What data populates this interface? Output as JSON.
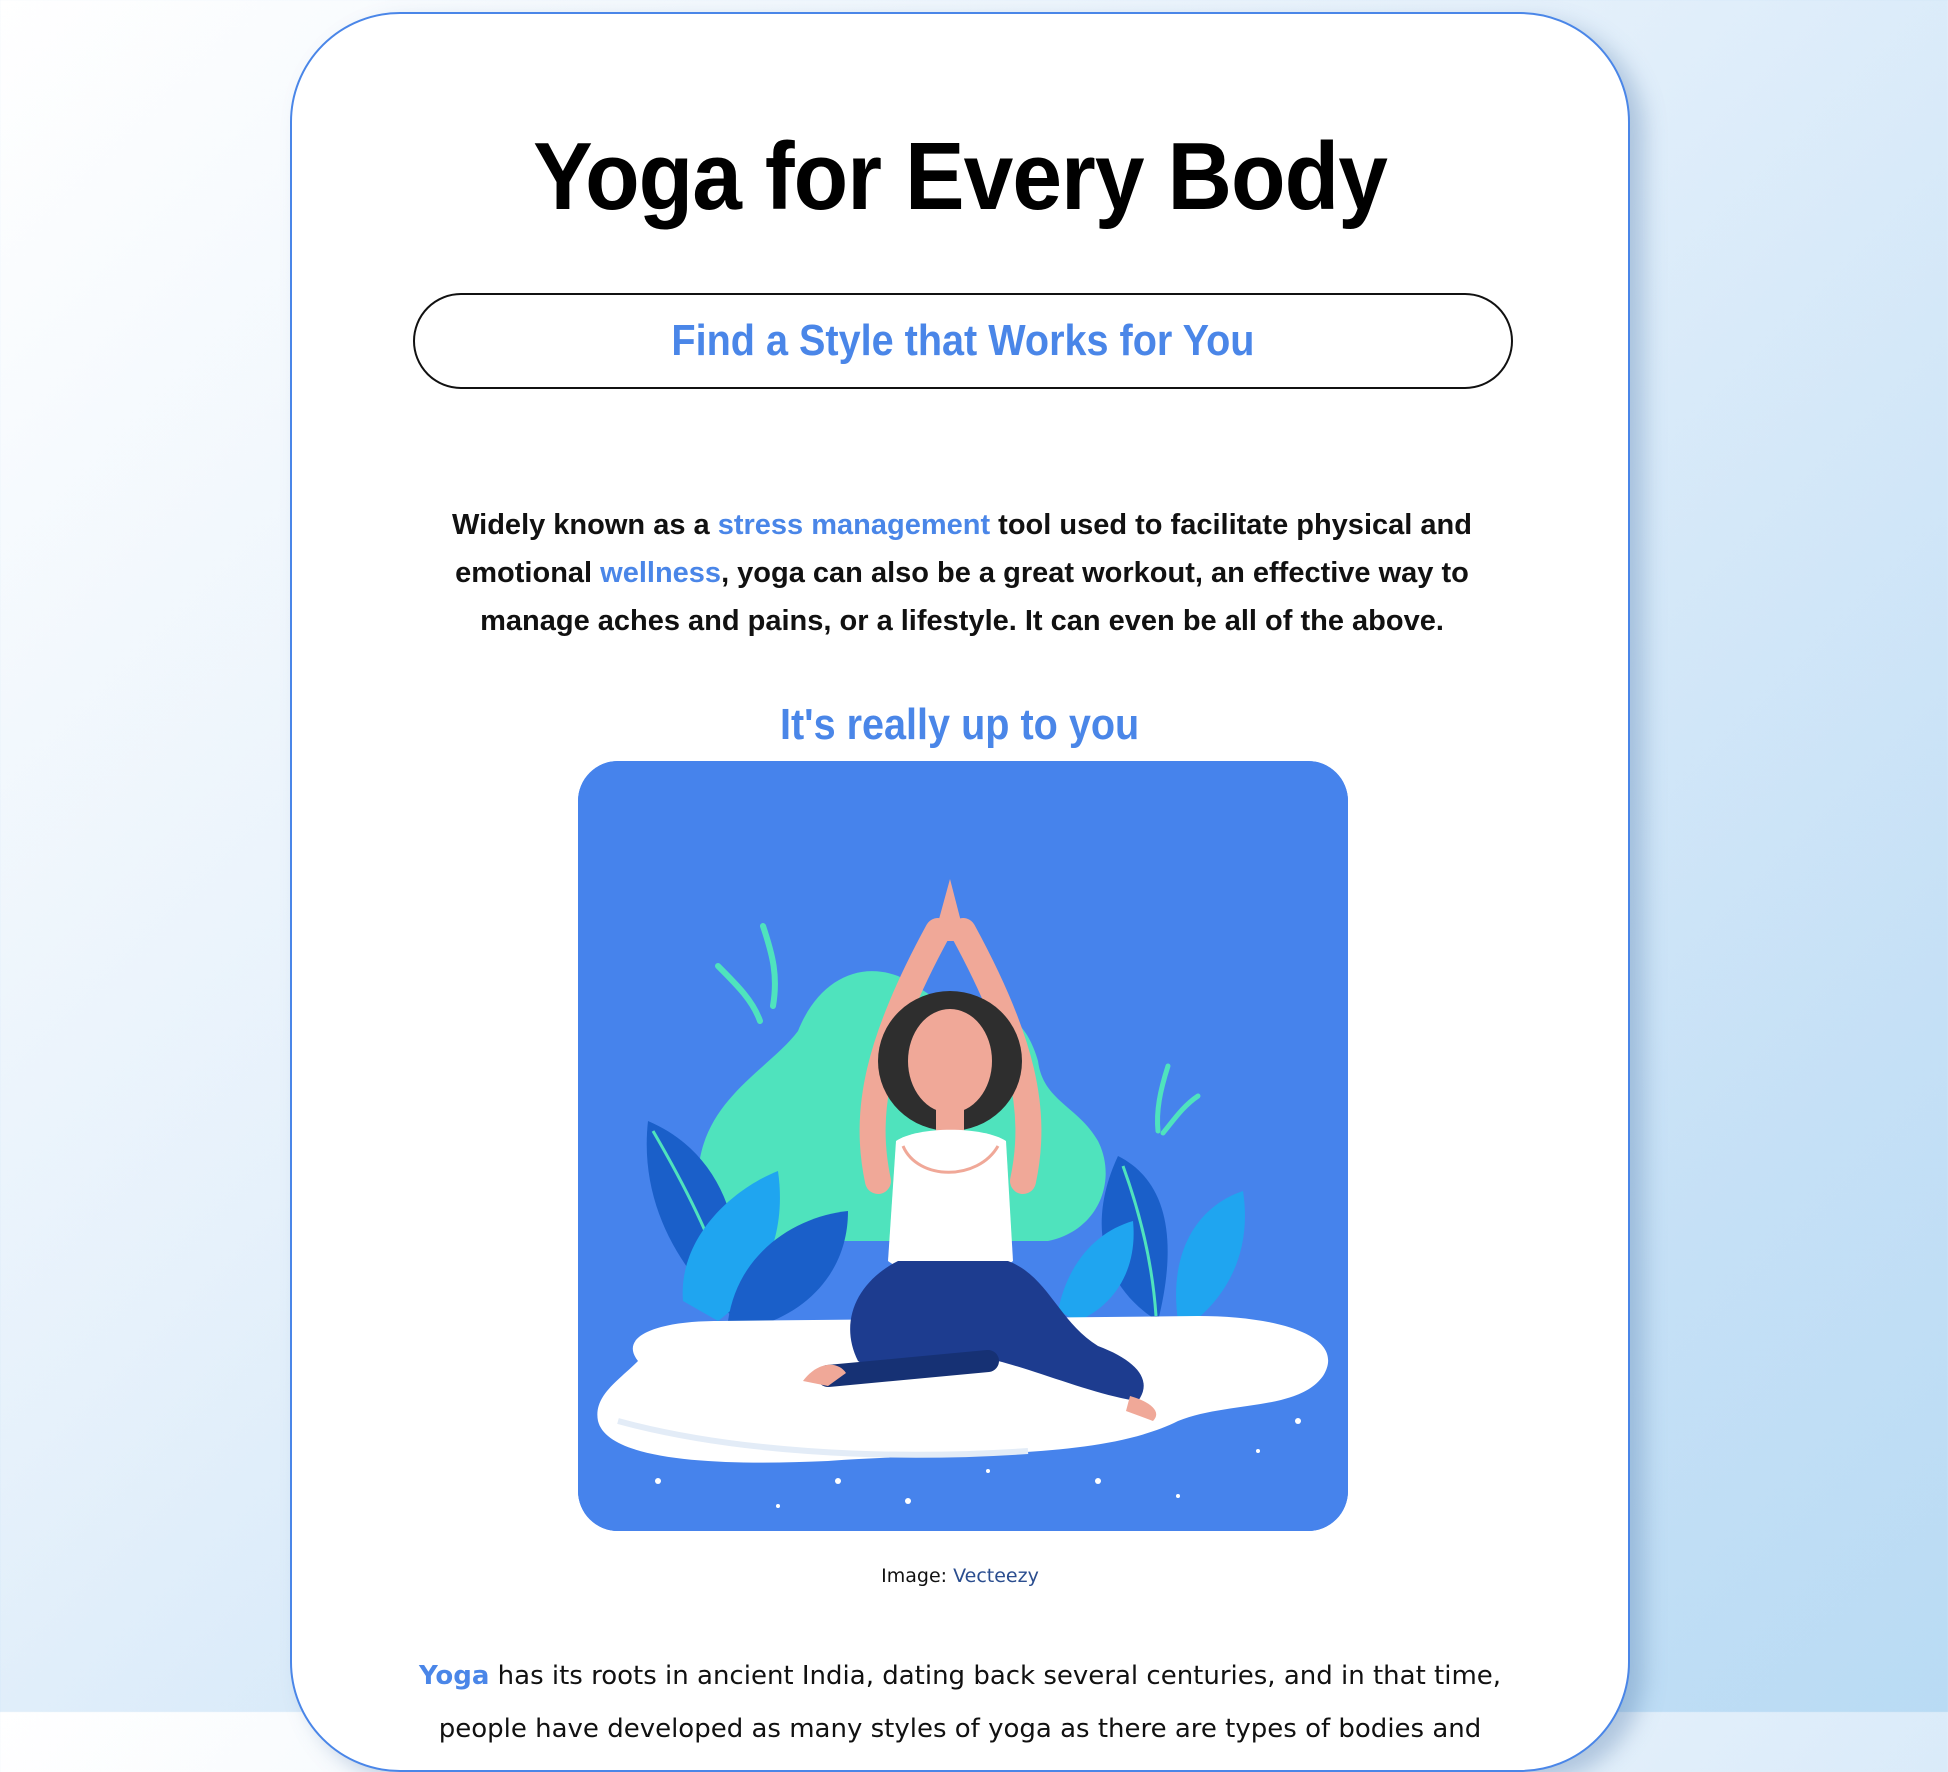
{
  "page": {
    "title": "Yoga for Every Body",
    "subtitle": "Find a Style that Works for You"
  },
  "intro": {
    "part1": "Widely known as a ",
    "link1": "stress management",
    "part2": " tool used to facilitate physical and emotional ",
    "link2": "wellness",
    "part3": ", yoga can also be a great workout, an effective way to manage aches and pains, or a lifestyle. It can even be all of the above."
  },
  "section": {
    "heading": "It's really up to you"
  },
  "image": {
    "caption_prefix": "Image: ",
    "caption_link": "Vecteezy"
  },
  "body": {
    "link": "Yoga",
    "text": " has its roots in ancient India, dating back several centuries, and in that time, people have developed as many styles of yoga as there are types of bodies and"
  },
  "colors": {
    "accent": "#4a86e8",
    "illustration_bg": "#4683ec",
    "leaf_mint": "#4fe3bd",
    "leaf_blue": "#1d6fd8"
  }
}
